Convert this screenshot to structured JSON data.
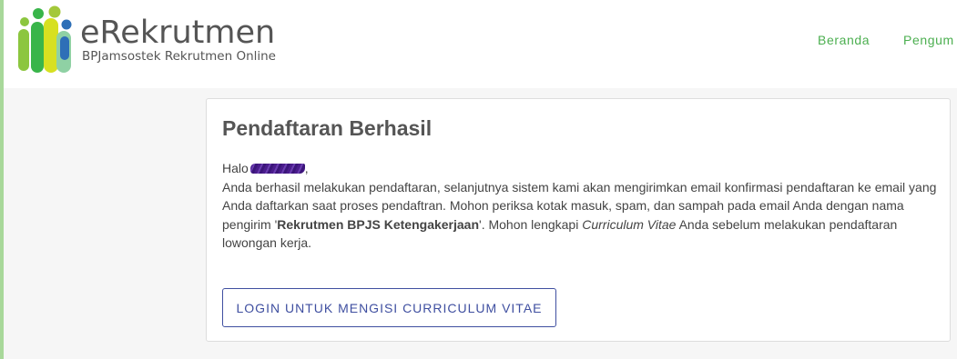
{
  "header": {
    "logo": {
      "title": "eRekrutmen",
      "subtitle": "BPJamsostek Rekrutmen Online"
    },
    "nav": [
      {
        "label": "Beranda"
      },
      {
        "label": "Pengum"
      }
    ]
  },
  "main": {
    "title": "Pendaftaran Berhasil",
    "greeting": "Halo",
    "greeting_suffix": ",",
    "paragraph_part1": "Anda berhasil melakukan pendaftaran, selanjutnya sistem kami akan mengirimkan email konfirmasi pendaftaran ke email yang Anda daftarkan saat proses pendaftran. Mohon periksa kotak masuk, spam, dan sampah pada email Anda dengan nama pengirim '",
    "sender_name": "Rekrutmen BPJS Ketengakerjaan",
    "paragraph_part2": "'. Mohon lengkapi ",
    "cv_term": "Curriculum Vitae",
    "paragraph_part3": " Anda sebelum melakukan pendaftaran lowongan kerja.",
    "login_button": "LOGIN UNTUK MENGISI CURRICULUM VITAE"
  },
  "colors": {
    "nav": "#4caf50",
    "button_border": "#3f4fa0",
    "title_text": "#555555",
    "redaction": "#4a1c8c"
  }
}
